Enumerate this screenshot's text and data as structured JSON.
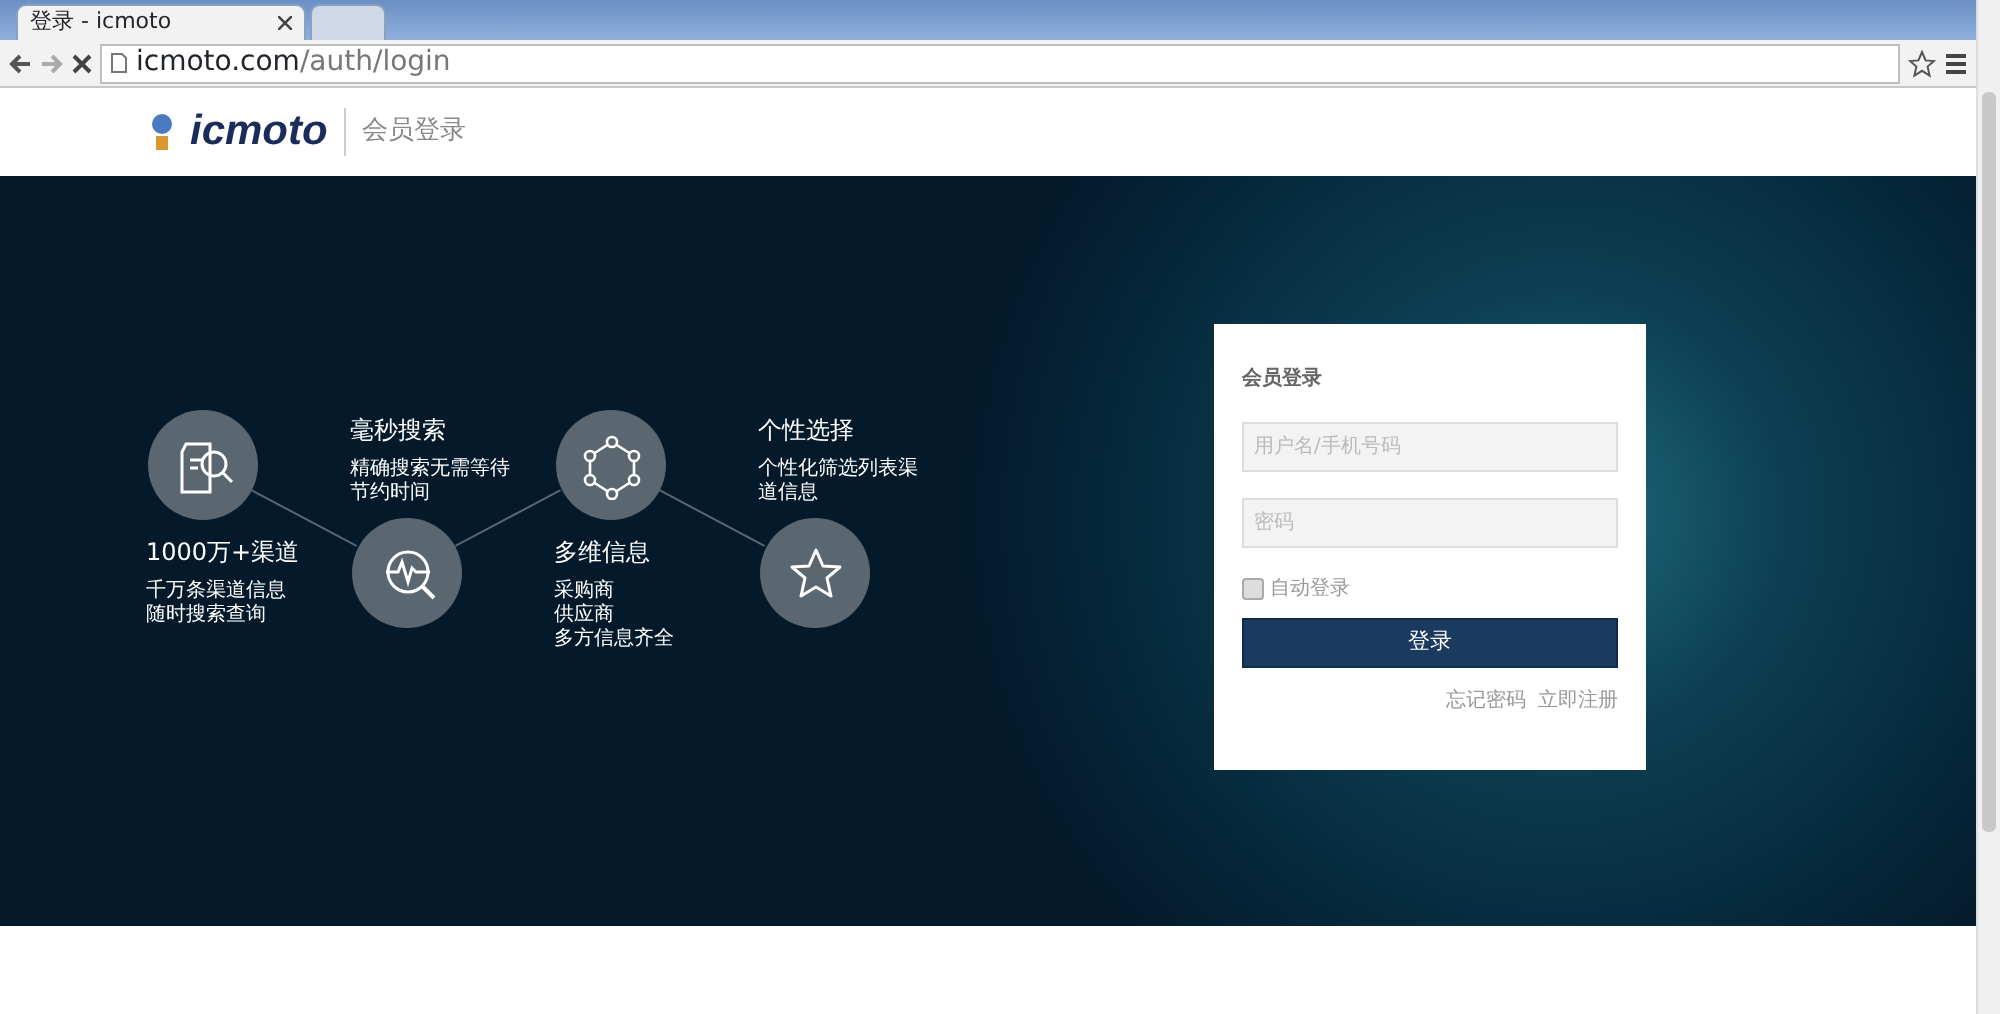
{
  "browser": {
    "tabs": [
      {
        "title": "登录 - icmoto",
        "selected": true
      },
      {
        "selected": false
      }
    ],
    "url_host": "icmoto.com",
    "url_path": "/auth/login"
  },
  "header": {
    "logo": "icmoto",
    "subtitle": "会员登录"
  },
  "features": [
    {
      "kind": "upper",
      "title": "1000万+渠道",
      "lines": [
        "千万条渠道信息",
        "随时搜索查询"
      ]
    },
    {
      "kind": "lower",
      "title": "毫秒搜索",
      "lines": [
        "精确搜索无需等待",
        "节约时间"
      ]
    },
    {
      "kind": "upper",
      "title": "多维信息",
      "lines": [
        "采购商",
        "供应商",
        "多方信息齐全"
      ]
    },
    {
      "kind": "lower",
      "title": "个性选择",
      "lines": [
        "个性化筛选列表渠",
        "道信息"
      ]
    }
  ],
  "login": {
    "title": "会员登录",
    "username": {
      "placeholder": "用户名/手机号码"
    },
    "password": {
      "placeholder": "密码"
    },
    "remember": {
      "label": "自动登录",
      "checked": false
    },
    "submit": "登录",
    "links": [
      "忘记密码",
      "立即注册"
    ]
  }
}
